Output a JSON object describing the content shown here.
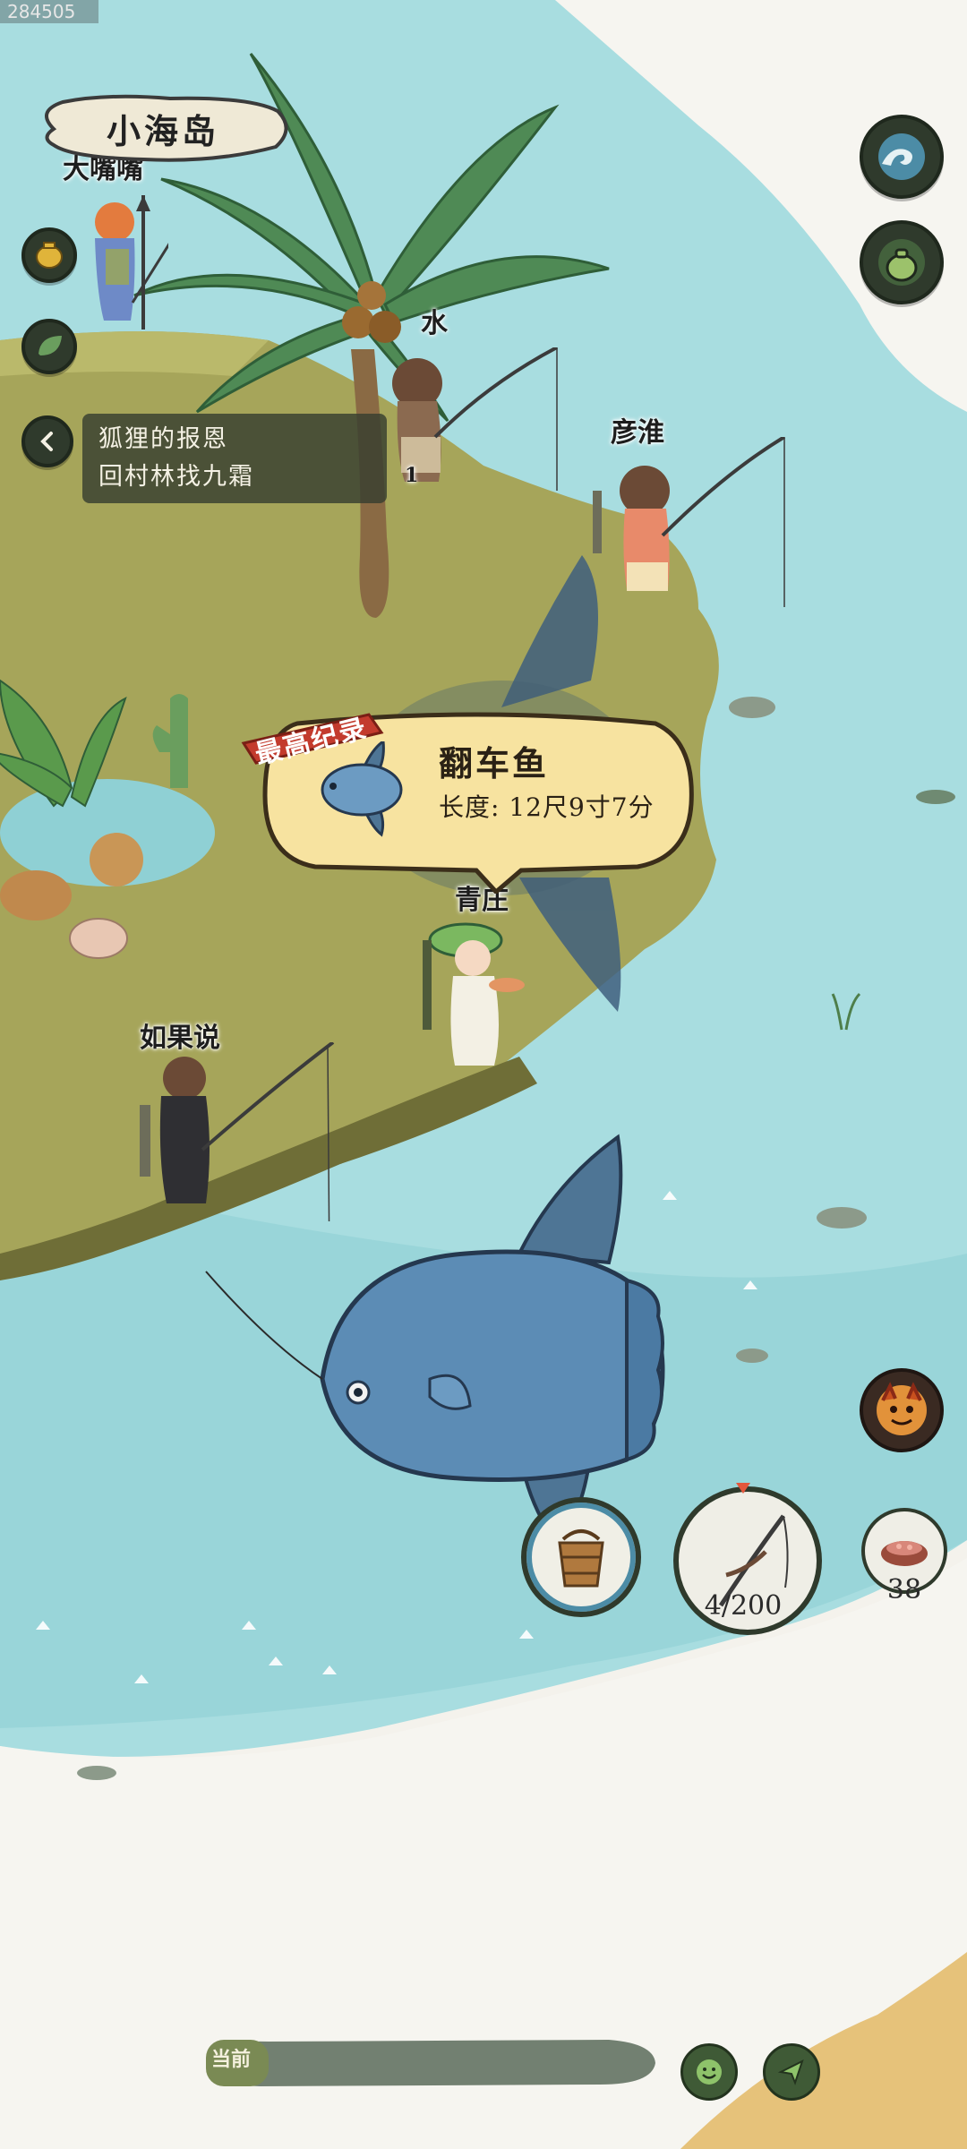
{
  "location": {
    "name": "小海岛"
  },
  "quest": {
    "title": "狐狸的报恩",
    "objective": "回村林找九霜"
  },
  "record": {
    "badge": "最高纪录",
    "fish_name": "翻车鱼",
    "length": "长度: 12尺9寸7分"
  },
  "players": [
    {
      "id": "top-left",
      "name": "大嘴嘴"
    },
    {
      "id": "center-top",
      "name": "水"
    },
    {
      "id": "right",
      "name": "彦淮"
    },
    {
      "id": "center",
      "name": "青庄"
    },
    {
      "id": "left",
      "name": "如果说"
    }
  ],
  "fisher_level": "1",
  "tools": {
    "rod_durability": "4/200",
    "bait_count": "38"
  },
  "chat": {
    "label": "当前"
  },
  "corner_watermark": "284505",
  "icons": {
    "wave": "wave-icon",
    "pot": "pot-icon",
    "coin_pouch": "coin-pouch-icon",
    "leaf": "leaf-icon",
    "back": "chevron-left-icon",
    "demon": "demon-mask-icon",
    "bucket": "bucket-icon",
    "rod": "fishing-rod-icon",
    "bait": "bait-bowl-icon",
    "emoji": "smile-icon",
    "send": "send-icon"
  },
  "colors": {
    "sea": "#a8dde0",
    "land": "#a6a55a",
    "ui_dark": "#2f3a2c",
    "record_red": "#c33b2d",
    "bubble": "#f7e3a0"
  }
}
